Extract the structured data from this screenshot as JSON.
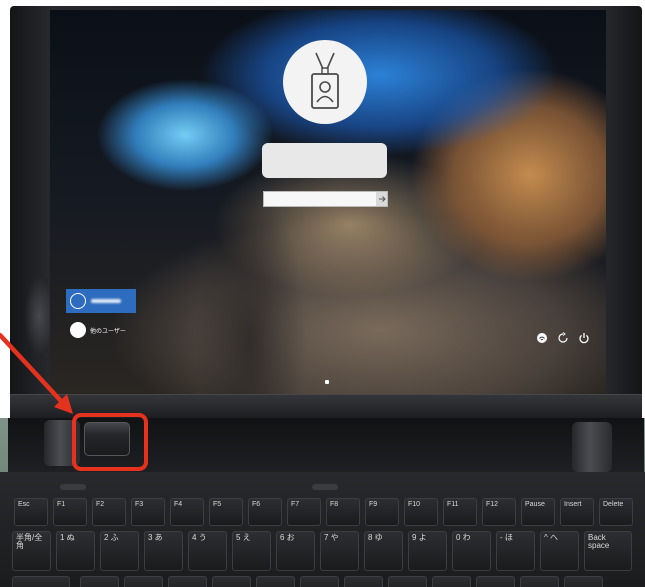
{
  "lock_screen": {
    "other_user_label": "他のユーザー"
  },
  "keyboard": {
    "function_row": [
      "Esc",
      "F1",
      "F2",
      "F3",
      "F4",
      "F5",
      "F6",
      "F7",
      "F8",
      "F9",
      "F10",
      "F11",
      "F12",
      "Pause",
      "Insert",
      "Delete"
    ],
    "number_row": [
      "半角/全角",
      "1 ぬ",
      "2 ふ",
      "3 あ",
      "4 う",
      "5 え",
      "6 お",
      "7 や",
      "8 ゆ",
      "9 よ",
      "0 わ",
      "- ほ",
      "^ へ",
      "Back space"
    ]
  },
  "icons": {
    "avatar": "id-badge-icon",
    "user_item": "user-circle-icon",
    "submit": "arrow-right-icon",
    "network": "network-icon",
    "ease_of_access": "ease-of-access-icon",
    "power": "power-icon",
    "annotation": "red-arrow-icon"
  },
  "colors": {
    "annotation": "#e5321f",
    "selected_user": "#2e6cc0",
    "bezel": "#1b1c1f"
  }
}
